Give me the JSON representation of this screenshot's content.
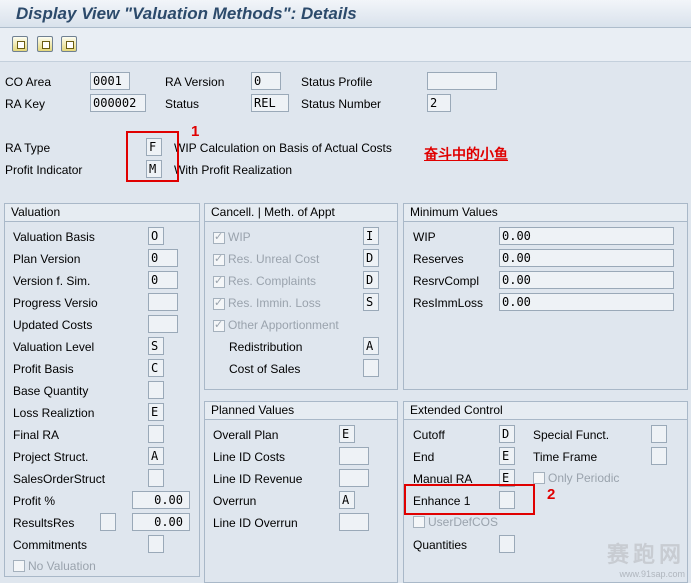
{
  "title": "Display View \"Valuation Methods\": Details",
  "header": {
    "co_area_label": "CO Area",
    "co_area": "0001",
    "ra_version_label": "RA Version",
    "ra_version": "0",
    "status_profile_label": "Status Profile",
    "status_profile": "",
    "ra_key_label": "RA Key",
    "ra_key": "000002",
    "status_label": "Status",
    "status": "REL",
    "status_number_label": "Status Number",
    "status_number": "2",
    "ra_type_label": "RA Type",
    "ra_type": "F",
    "ra_type_desc": "WIP Calculation on Basis of Actual Costs",
    "profit_indicator_label": "Profit Indicator",
    "profit_indicator": "M",
    "profit_indicator_desc": "With Profit Realization"
  },
  "annotations": {
    "mark1": "1",
    "mark2": "2",
    "author": "奋斗中的小鱼"
  },
  "valuation": {
    "title": "Valuation",
    "rows": [
      {
        "label": "Valuation Basis",
        "value": "O"
      },
      {
        "label": "Plan Version",
        "value": "0"
      },
      {
        "label": "Version f. Sim.",
        "value": "0"
      },
      {
        "label": "Progress Versio",
        "value": ""
      },
      {
        "label": "Updated Costs",
        "value": ""
      },
      {
        "label": "Valuation Level",
        "value": "S"
      },
      {
        "label": "Profit Basis",
        "value": "C"
      },
      {
        "label": "Base Quantity",
        "value": ""
      },
      {
        "label": "Loss Realiztion",
        "value": "E"
      },
      {
        "label": "Final RA",
        "value": ""
      },
      {
        "label": "Project Struct.",
        "value": "A"
      },
      {
        "label": "SalesOrderStruct",
        "value": ""
      }
    ],
    "profit_pct_label": "Profit %",
    "profit_pct": "0.00",
    "results_res_label": "ResultsRes",
    "results_res": "0.00",
    "commitments_label": "Commitments",
    "commitments": "",
    "no_valuation_label": "No Valuation"
  },
  "cancell": {
    "title": "Cancell. | Meth. of Appt",
    "rows": [
      {
        "label": "WIP",
        "value": "I"
      },
      {
        "label": "Res. Unreal Cost",
        "value": "D"
      },
      {
        "label": "Res. Complaints",
        "value": "D"
      },
      {
        "label": "Res. Immin. Loss",
        "value": "S"
      }
    ],
    "other_label": "Other Apportionment",
    "redistribution_label": "Redistribution",
    "redistribution": "A",
    "cost_of_sales_label": "Cost of Sales",
    "cost_of_sales": ""
  },
  "minimum": {
    "title": "Minimum Values",
    "rows": [
      {
        "label": "WIP",
        "value": "0.00"
      },
      {
        "label": "Reserves",
        "value": "0.00"
      },
      {
        "label": "ResrvCompl",
        "value": "0.00"
      },
      {
        "label": "ResImmLoss",
        "value": "0.00"
      }
    ]
  },
  "planned": {
    "title": "Planned Values",
    "rows": [
      {
        "label": "Overall Plan",
        "value": "E"
      },
      {
        "label": "Line ID Costs",
        "value": ""
      },
      {
        "label": "Line ID Revenue",
        "value": ""
      },
      {
        "label": "Overrun",
        "value": "A"
      },
      {
        "label": "Line ID Overrun",
        "value": ""
      }
    ]
  },
  "extended": {
    "title": "Extended Control",
    "cutoff_label": "Cutoff",
    "cutoff": "D",
    "special_label": "Special Funct.",
    "special": "",
    "end_label": "End",
    "end": "E",
    "time_frame_label": "Time Frame",
    "time_frame": "",
    "manual_ra_label": "Manual RA",
    "manual_ra": "E",
    "only_periodic_label": "Only Periodic",
    "enhance_label": "Enhance 1",
    "enhance": "",
    "userdefcos_label": "UserDefCOS",
    "quantities_label": "Quantities",
    "quantities": ""
  },
  "watermark": {
    "text": "赛跑网",
    "url": "www.91sap.com"
  }
}
